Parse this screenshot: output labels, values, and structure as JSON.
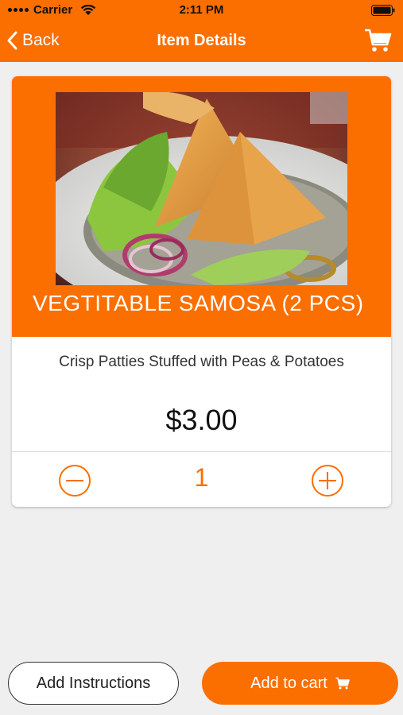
{
  "status_bar": {
    "carrier": "Carrier",
    "time": "2:11 PM"
  },
  "navbar": {
    "back_label": "Back",
    "title": "Item Details",
    "cart_icon": "cart-icon"
  },
  "item": {
    "name": "VEGTITABLE SAMOSA (2 PCS)",
    "description": "Crisp Patties Stuffed with Peas & Potatoes",
    "price": "$3.00",
    "quantity": "1"
  },
  "actions": {
    "add_instructions_label": "Add Instructions",
    "add_to_cart_label": "Add to cart"
  },
  "colors": {
    "accent": "#fb6e00",
    "background": "#efeff0"
  }
}
